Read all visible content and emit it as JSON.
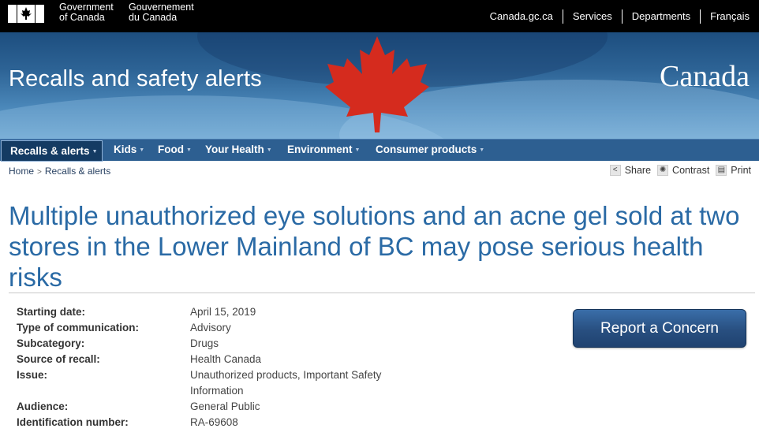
{
  "top": {
    "goc_en": [
      "Government",
      "of Canada"
    ],
    "goc_fr": [
      "Gouvernement",
      "du Canada"
    ],
    "links": [
      "Canada.gc.ca",
      "Services",
      "Departments",
      "Français"
    ]
  },
  "banner": {
    "title": "Recalls and safety alerts",
    "wordmark": "Canada"
  },
  "nav": {
    "items": [
      "Recalls & alerts",
      "Kids",
      "Food",
      "Your Health",
      "Environment",
      "Consumer products"
    ]
  },
  "breadcrumb": {
    "home": "Home",
    "current": "Recalls & alerts"
  },
  "tools": {
    "share": "Share",
    "contrast": "Contrast",
    "print": "Print"
  },
  "headline": "Multiple unauthorized eye solutions and an acne gel sold at two stores in the Lower Mainland of BC may pose serious health risks",
  "details": [
    {
      "label": "Starting date:",
      "value": "April 15, 2019"
    },
    {
      "label": "Type of communication:",
      "value": "Advisory"
    },
    {
      "label": "Subcategory:",
      "value": "Drugs"
    },
    {
      "label": "Source of recall:",
      "value": "Health Canada"
    },
    {
      "label": "Issue:",
      "value": "Unauthorized products, Important Safety Information"
    },
    {
      "label": "Audience:",
      "value": "General Public"
    },
    {
      "label": "Identification number:",
      "value": "RA-69608"
    }
  ],
  "report_button": "Report a Concern",
  "colors": {
    "nav_bg": "#2d5f91",
    "headline": "#2a6aa5",
    "leaf": "#d52b1e"
  }
}
